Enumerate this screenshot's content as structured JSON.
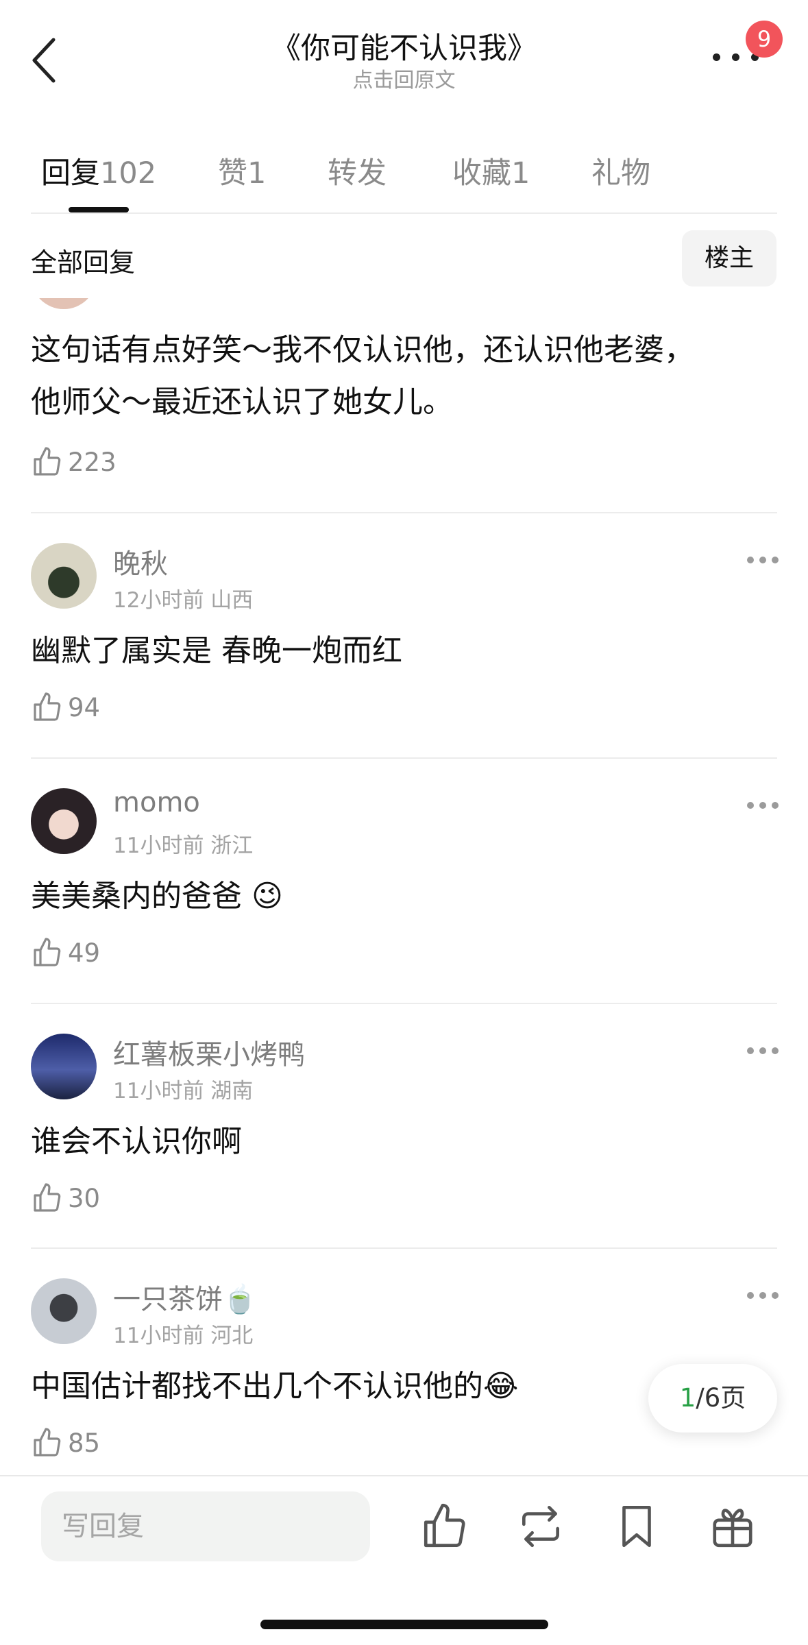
{
  "header": {
    "title": "《你可能不认识我》",
    "subtitle": "点击回原文",
    "badge_count": "9",
    "back_icon": "chevron-left-icon",
    "more_icon": "more-horizontal-icon"
  },
  "tabs": [
    {
      "label": "回复",
      "count": "102"
    },
    {
      "label": "赞",
      "count": "1"
    },
    {
      "label": "转发",
      "count": ""
    },
    {
      "label": "收藏",
      "count": "1"
    },
    {
      "label": "礼物",
      "count": ""
    }
  ],
  "section": {
    "title": "全部回复",
    "filter_button": "楼主"
  },
  "comments": [
    {
      "username": "",
      "meta": "",
      "text_lines": [
        "这句话有点好笑～我不仅认识他，还认识他老婆，",
        "他师父～最近还认识了她女儿。"
      ],
      "likes": "223"
    },
    {
      "username": "晚秋",
      "meta": "12小时前 山西",
      "text": "幽默了属实是 春晚一炮而红",
      "likes": "94"
    },
    {
      "username": "momo",
      "meta": "11小时前 浙江",
      "text": "美美桑内的爸爸 😉",
      "likes": "49"
    },
    {
      "username": "红薯板栗小烤鸭",
      "meta": "11小时前 湖南",
      "text": "谁会不认识你啊",
      "likes": "30"
    },
    {
      "username": "一只茶饼🍵",
      "meta": "11小时前 河北",
      "text": "中国估计都找不出几个不认识他的😂",
      "likes": "85"
    }
  ],
  "pager": {
    "current": "1",
    "rest": "/6页"
  },
  "bottom_bar": {
    "reply_placeholder": "写回复",
    "icons": [
      "thumbs-up-icon",
      "repost-icon",
      "bookmark-icon",
      "gift-icon"
    ]
  },
  "colors": {
    "accent_green": "#27a045",
    "badge_red": "#f2545b"
  }
}
